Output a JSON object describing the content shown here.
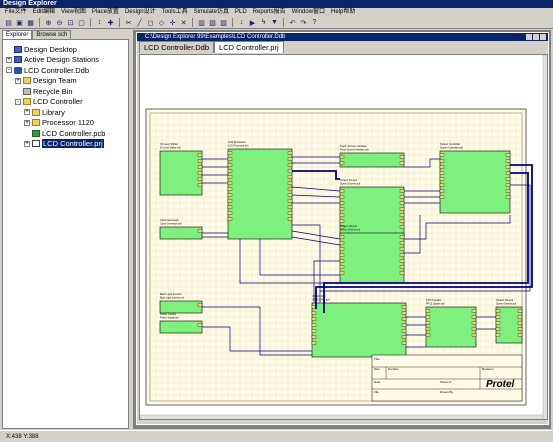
{
  "app": {
    "title": "Design Explorer"
  },
  "menu": [
    "File文件",
    "Edit编辑",
    "View视图",
    "Place放置",
    "Design设计",
    "Tools工具",
    "Simulate仿真",
    "PLD",
    "Reports报告",
    "Window窗口",
    "Help帮助"
  ],
  "panel": {
    "tabs": [
      "Explorer",
      "Browse sch"
    ],
    "tree": [
      {
        "label": "Design Desktop",
        "icon": "desktop-icon",
        "level": 0,
        "expander": ""
      },
      {
        "label": "Active Design Stations",
        "icon": "station-icon",
        "level": 0,
        "expander": "+"
      },
      {
        "label": "LCD Controller.Ddb",
        "icon": "database-icon",
        "level": 0,
        "expander": "-"
      },
      {
        "label": "Design Team",
        "icon": "team-icon",
        "level": 1,
        "expander": "+"
      },
      {
        "label": "Recycle Bin",
        "icon": "recycle-bin-icon",
        "level": 1,
        "expander": ""
      },
      {
        "label": "LCD Controller",
        "icon": "folder-icon",
        "level": 1,
        "expander": "-"
      },
      {
        "label": "Library",
        "icon": "folder-icon",
        "level": 2,
        "expander": "+"
      },
      {
        "label": "Processor 1120",
        "icon": "folder-icon",
        "level": 2,
        "expander": "+"
      },
      {
        "label": "LCD Controller.pcb",
        "icon": "pcb-file-icon",
        "level": 2,
        "expander": ""
      },
      {
        "label": "LCD Controller.prj",
        "icon": "schematic-file-icon",
        "level": 2,
        "expander": "+",
        "selected": true
      }
    ]
  },
  "document": {
    "window_title": "C:\\Design Explorer 99\\Examples\\LCD Controller.Ddb",
    "tabs": [
      "LCD Controller.Ddb",
      "LCD Controller.prj"
    ],
    "active_tab": 1
  },
  "schematic": {
    "logo": "Protel",
    "sheet_symbols": [
      {
        "title": "IO Level Shifter",
        "file": "IO Level Shifter.sch"
      },
      {
        "title": "LCD Processor",
        "file": "LCD Processor.sch"
      },
      {
        "title": "Touch Screen Interface",
        "file": "Touch Screen Interface.sch"
      },
      {
        "title": "Screen Controller",
        "file": "Screen Controller.sch"
      },
      {
        "title": "Screen Drivers",
        "file": "Screen Drivers.sch"
      },
      {
        "title": "Clock Generator",
        "file": "Clock Generator.sch"
      },
      {
        "title": "Back Light Inverter",
        "file": "Back Light Inverter.sch"
      },
      {
        "title": "Power Supply",
        "file": "Power Supply.sch"
      },
      {
        "title": "VIDEO DAC",
        "file": "VIDEO DAC.sch"
      },
      {
        "title": "PPC3 Quartz",
        "file": "PPC3 Quartz.sch"
      },
      {
        "title": "Screen Drivers",
        "file": "Screen Drivers.sch"
      }
    ],
    "title_block": {
      "title": "Title",
      "size": "Size",
      "number": "Number",
      "revision": "Revision",
      "date": "Date",
      "file": "File",
      "sheet": "Sheet of",
      "drawn_by": "Drawn By"
    }
  },
  "status": {
    "coords": "X:438 Y:388"
  },
  "colors": {
    "sheet_symbol": "#7ef07e",
    "wire": "#000080",
    "bus": "#000080",
    "port": "#ffd070",
    "sheet": "#fffbe6",
    "grid": "#e0d8b0"
  }
}
